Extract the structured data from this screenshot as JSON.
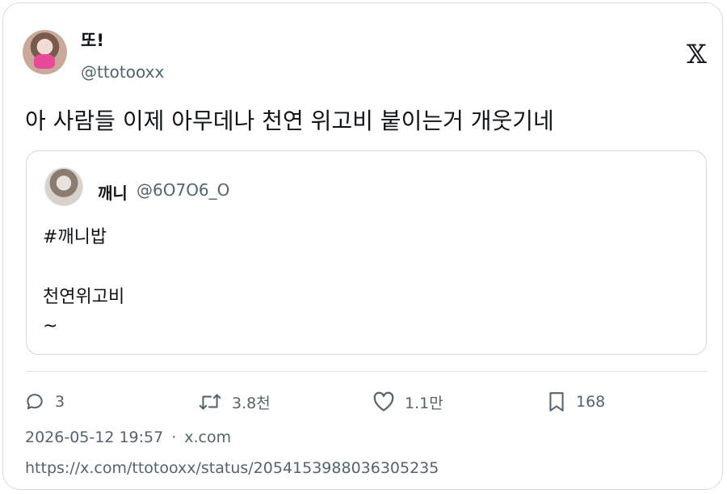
{
  "author": {
    "display_name": "또!",
    "handle": "@ttotooxx"
  },
  "brand": {
    "logo_icon": "x-logo-icon",
    "logo_text": "𝕏"
  },
  "tweet": {
    "text": "아 사람들 이제 아무데나 천연 위고비 붙이는거 개웃기네"
  },
  "quoted": {
    "display_name": "깨니",
    "handle": "@6O7O6_O",
    "lines": [
      "#깨니밥",
      "천연위고비",
      "~"
    ]
  },
  "actions": {
    "reply": {
      "icon": "reply-icon",
      "count": "3"
    },
    "retweet": {
      "icon": "retweet-icon",
      "count": "3.8천"
    },
    "like": {
      "icon": "heart-icon",
      "count": "1.1만"
    },
    "bookmark": {
      "icon": "bookmark-icon",
      "count": "168"
    }
  },
  "meta": {
    "timestamp": "2026-05-12 19:57",
    "separator": "·",
    "source": "x.com"
  },
  "url": "https://x.com/ttotooxx/status/2054153988036305235",
  "colors": {
    "text": "#0f1419",
    "muted": "#536471",
    "border": "#cfd9de"
  }
}
